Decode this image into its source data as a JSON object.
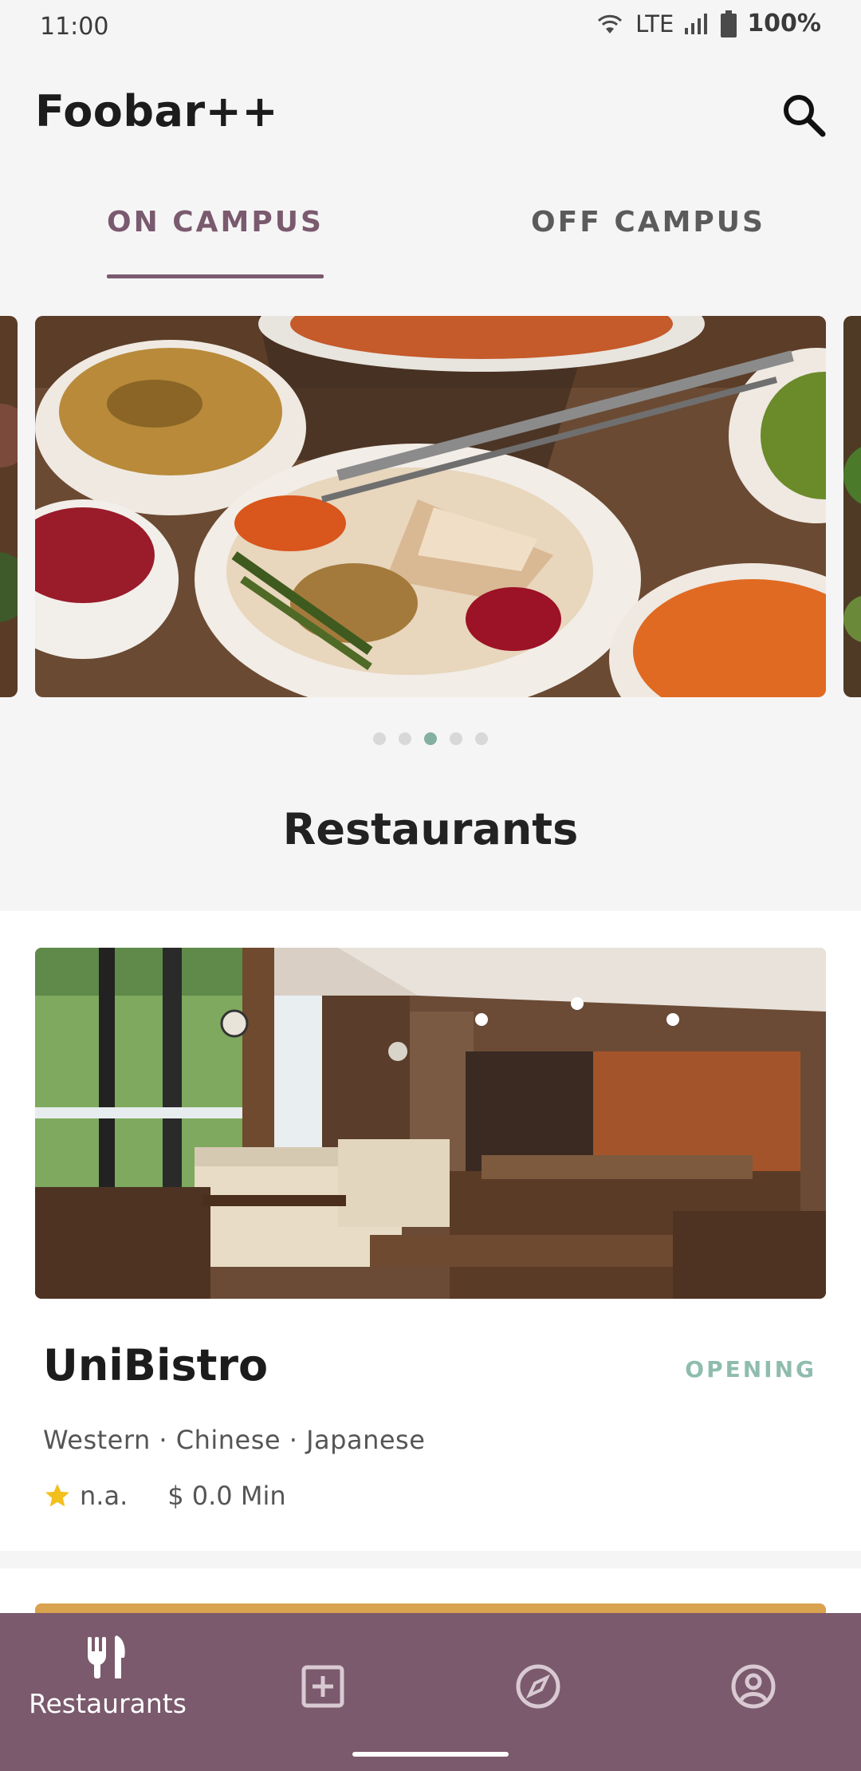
{
  "status_bar": {
    "time": "11:00",
    "network": "LTE",
    "battery": "100%"
  },
  "app_bar": {
    "title": "Foobar++",
    "search_icon": "search-icon"
  },
  "tabs": [
    {
      "label": "ON CAMPUS",
      "selected": true
    },
    {
      "label": "OFF CAMPUS",
      "selected": false
    }
  ],
  "carousel": {
    "slide_count": 5,
    "active_index": 2
  },
  "section_title": "Restaurants",
  "restaurants": [
    {
      "name": "UniBistro",
      "status": "OPENING",
      "cuisines": "Western · Chinese · Japanese",
      "rating": "n.a.",
      "min_price": "$ 0.0 Min"
    }
  ],
  "bottom_nav": [
    {
      "label": "Restaurants",
      "icon": "fork-knife-icon",
      "selected": true
    },
    {
      "label": "",
      "icon": "add-box-icon",
      "selected": false
    },
    {
      "label": "",
      "icon": "compass-icon",
      "selected": false
    },
    {
      "label": "",
      "icon": "account-circle-icon",
      "selected": false
    }
  ],
  "colors": {
    "accent": "#7a5a6e",
    "nav_background": "#7a5a6c",
    "open_status": "#8fbcae",
    "star": "#f2c01e",
    "page_background": "#f6f5f6"
  }
}
